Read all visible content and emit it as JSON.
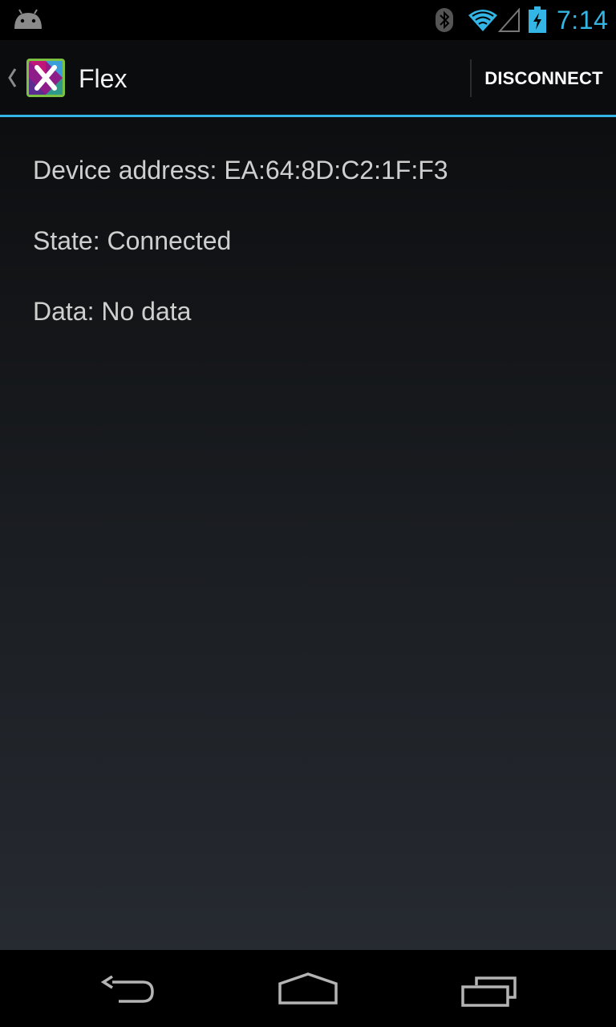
{
  "status_bar": {
    "time": "7:14",
    "accent_color": "#33b5e5",
    "icons": [
      "android-debug-icon",
      "bluetooth-icon",
      "wifi-icon",
      "signal-icon",
      "battery-charging-icon"
    ]
  },
  "action_bar": {
    "title": "Flex",
    "app_icon": "flex-x-logo",
    "action_label": "DISCONNECT",
    "accent_color": "#33b5e5"
  },
  "device": {
    "address_text": "Device address: EA:64:8D:C2:1F:F3",
    "state_text": "State: Connected",
    "data_text": "Data: No data"
  },
  "nav_bar": {
    "buttons": [
      "back-icon",
      "home-icon",
      "recents-icon"
    ]
  }
}
